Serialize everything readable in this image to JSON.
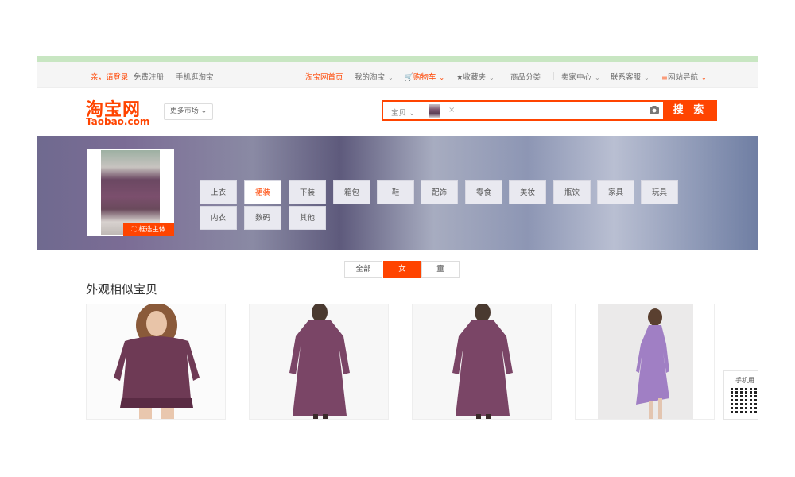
{
  "topbar": {
    "login": "亲，请登录",
    "register": "免费注册",
    "mobile": "手机逛淘宝",
    "home": "淘宝网首页",
    "my_taobao": "我的淘宝",
    "cart": "购物车",
    "favorites": "收藏夹",
    "categories": "商品分类",
    "seller_center": "卖家中心",
    "contact": "联系客服",
    "site_nav": "网站导航"
  },
  "logo": {
    "cn": "淘宝网",
    "en": "Taobao.com"
  },
  "more_market": "更多市场",
  "search": {
    "type": "宝贝",
    "value": "",
    "button": "搜 索"
  },
  "banner": {
    "crop_button": "框选主体",
    "categories": [
      "上衣",
      "裙装",
      "下装",
      "箱包",
      "鞋",
      "配饰",
      "零食",
      "美妆",
      "瓶饮",
      "家具",
      "玩具",
      "内衣",
      "数码",
      "其他"
    ],
    "active_category": "裙装"
  },
  "filters": {
    "all": "全部",
    "female": "女",
    "child": "童",
    "active": "女"
  },
  "section_title": "外观相似宝贝",
  "side_qr": {
    "label": "手机用"
  },
  "colors": {
    "accent": "#ff4400",
    "banner": "#7b7fa0"
  }
}
